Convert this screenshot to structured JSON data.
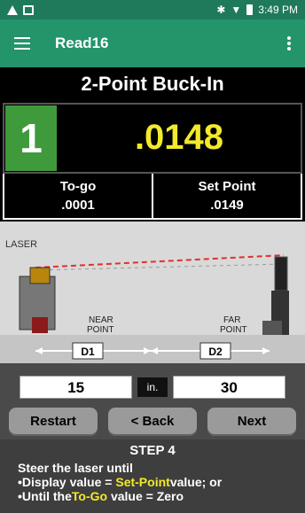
{
  "statusbar": {
    "time": "3:49 PM"
  },
  "appbar": {
    "title": "Read16"
  },
  "screen": {
    "title": "2-Point Buck-In"
  },
  "readout": {
    "step": "1",
    "value": ".0148"
  },
  "info": {
    "togo_label": "To-go",
    "togo_value": ".0001",
    "setpoint_label": "Set Point",
    "setpoint_value": ".0149"
  },
  "diagram": {
    "laser_label": "LASER",
    "near_label": "NEAR POINT",
    "far_label": "FAR POINT",
    "d1_label": "D1",
    "d2_label": "D2"
  },
  "inputs": {
    "d1_value": "15",
    "unit": "in.",
    "d2_value": "30"
  },
  "buttons": {
    "restart": "Restart",
    "back": "< Back",
    "next": "Next"
  },
  "step": {
    "title": "STEP 4"
  },
  "instructions": {
    "line1": "Steer the laser until",
    "line2_prefix": "•Display value = ",
    "line2_highlight": "Set-Point",
    "line2_suffix": "value; or",
    "line3_prefix": "•Until the",
    "line3_highlight": "To-Go",
    "line3_suffix": " value = Zero"
  },
  "colors": {
    "appbar": "#24946b",
    "statusbar": "#1f7a5c",
    "highlight": "#f2ea2a",
    "step_badge": "#3f9a3c"
  }
}
